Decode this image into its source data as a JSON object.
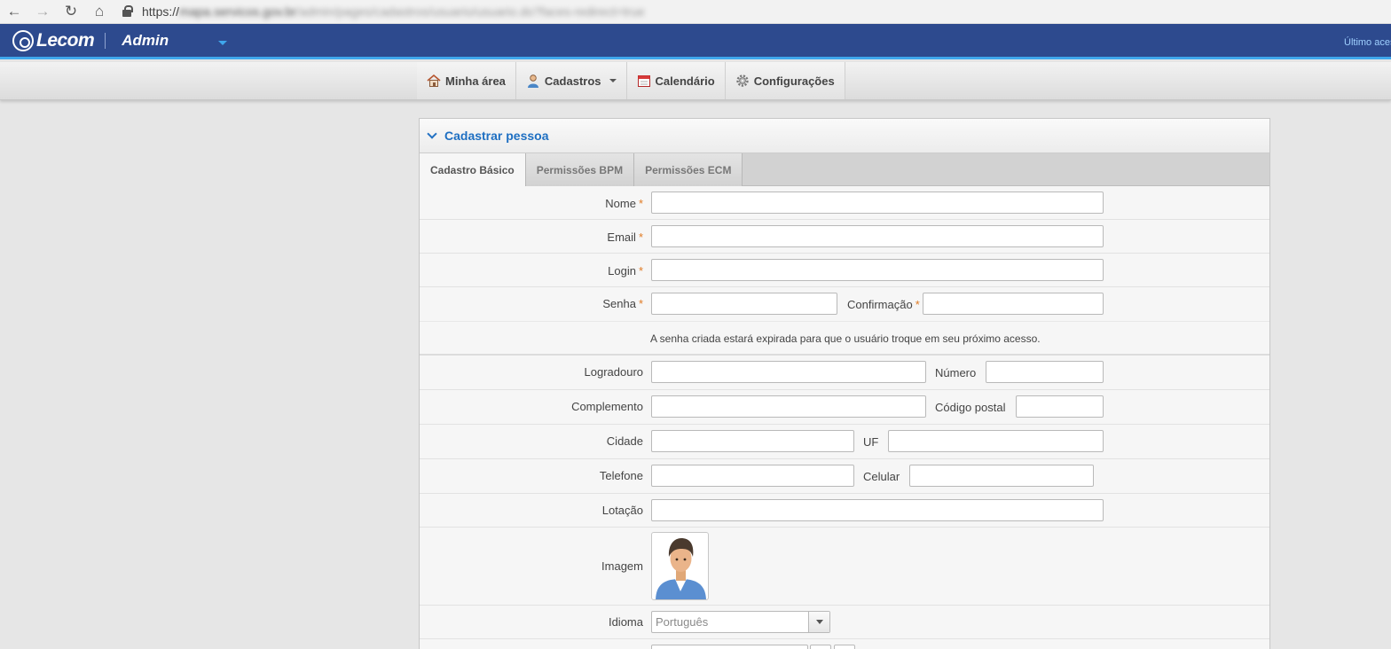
{
  "browser": {
    "url_scheme": "https://",
    "url_host": "mapa.servicos.gov.br",
    "url_path": "/admin/pages/cadastros/usuario/usuario.do?faces-redirect=true"
  },
  "header": {
    "logo": "Lecom",
    "app_name": "Admin",
    "last_access": "Último acesso"
  },
  "menu": [
    {
      "label": "Minha área",
      "icon": "home-icon"
    },
    {
      "label": "Cadastros",
      "icon": "user-icon"
    },
    {
      "label": "Calendário",
      "icon": "calendar-icon"
    },
    {
      "label": "Configurações",
      "icon": "gear-icon"
    }
  ],
  "panel": {
    "title": "Cadastrar pessoa",
    "tabs": [
      "Cadastro Básico",
      "Permissões BPM",
      "Permissões ECM"
    ]
  },
  "form": {
    "nome": "Nome",
    "email": "Email",
    "login": "Login",
    "senha": "Senha",
    "confirmacao": "Confirmação",
    "senha_hint": "A senha criada estará expirada para que o usuário troque em seu próximo acesso.",
    "logradouro": "Logradouro",
    "numero": "Número",
    "complemento": "Complemento",
    "codigo_postal": "Código postal",
    "cidade": "Cidade",
    "uf": "UF",
    "telefone": "Telefone",
    "celular": "Celular",
    "lotacao": "Lotação",
    "imagem": "Imagem",
    "idioma": "Idioma",
    "idioma_value": "Português",
    "required_mark": "*"
  },
  "colors": {
    "header_bg": "#2d4a8e",
    "accent": "#3fa7ec",
    "title_blue": "#1e6fc2",
    "required": "#e07b25"
  }
}
